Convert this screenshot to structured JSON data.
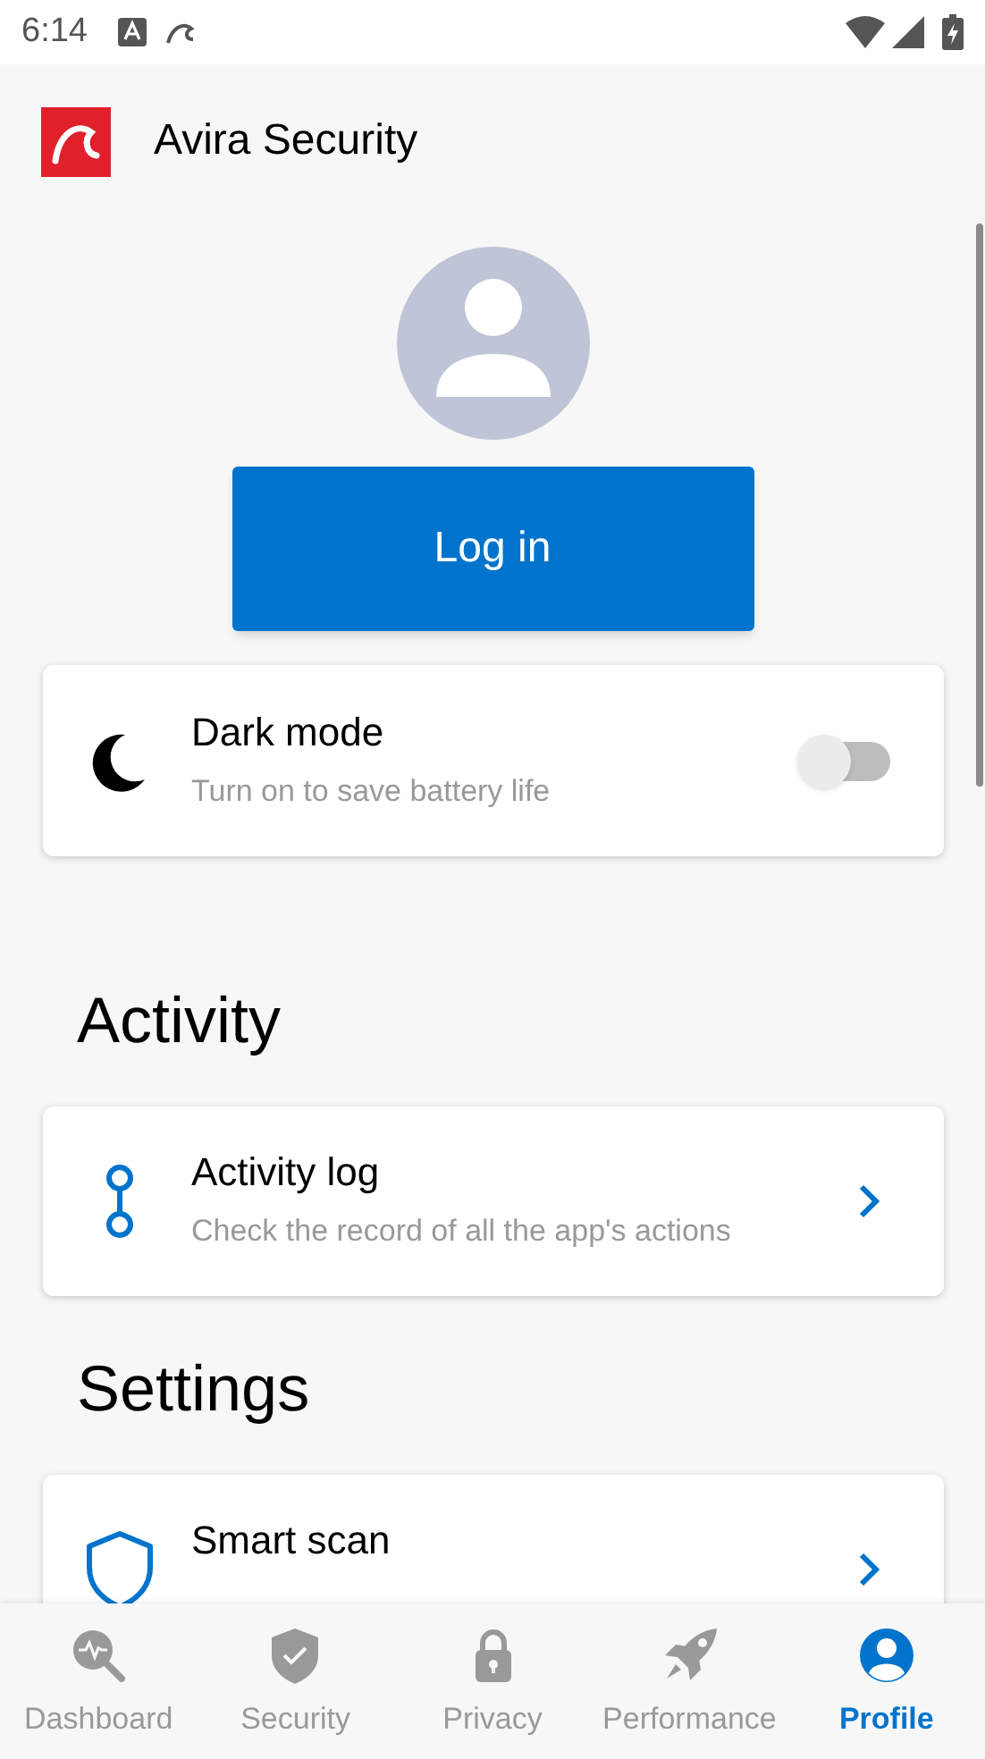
{
  "status_bar": {
    "time": "6:14"
  },
  "app_bar": {
    "title": "Avira Security"
  },
  "login_button": "Log in",
  "dark_mode": {
    "title": "Dark mode",
    "subtitle": "Turn on to save battery life",
    "on": false
  },
  "sections": [
    {
      "heading": "Activity",
      "items": [
        {
          "kind": "log",
          "title": "Activity log",
          "subtitle": "Check the record of all the app's actions"
        }
      ]
    },
    {
      "heading": "Settings",
      "items": [
        {
          "kind": "shield",
          "title": "Smart scan"
        }
      ]
    }
  ],
  "nav": [
    {
      "kind": "dashboard",
      "label": "Dashboard",
      "selected": false
    },
    {
      "kind": "security",
      "label": "Security",
      "selected": false
    },
    {
      "kind": "privacy",
      "label": "Privacy",
      "selected": false
    },
    {
      "kind": "performance",
      "label": "Performance",
      "selected": false
    },
    {
      "kind": "profile",
      "label": "Profile",
      "selected": true
    }
  ]
}
